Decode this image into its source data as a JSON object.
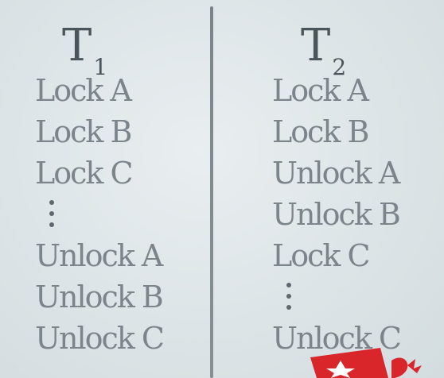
{
  "t1": {
    "heading": "T",
    "subscript": "1",
    "ops": [
      "Lock A",
      "Lock B",
      "Lock C",
      "Unlock A",
      "Unlock B",
      "Unlock C"
    ]
  },
  "t2": {
    "heading": "T",
    "subscript": "2",
    "ops": [
      "Lock A",
      "Lock B",
      "Unlock A",
      "Unlock B",
      "Lock C",
      "Unlock C"
    ]
  },
  "colors": {
    "background": "#dfe6e9",
    "heading": "#4a555b",
    "text": "#7b858b",
    "divider": "#6f7a80",
    "logo_red": "#d8262b"
  },
  "icons": [
    "ellipsis-vertical-icon",
    "star-logo-icon"
  ]
}
